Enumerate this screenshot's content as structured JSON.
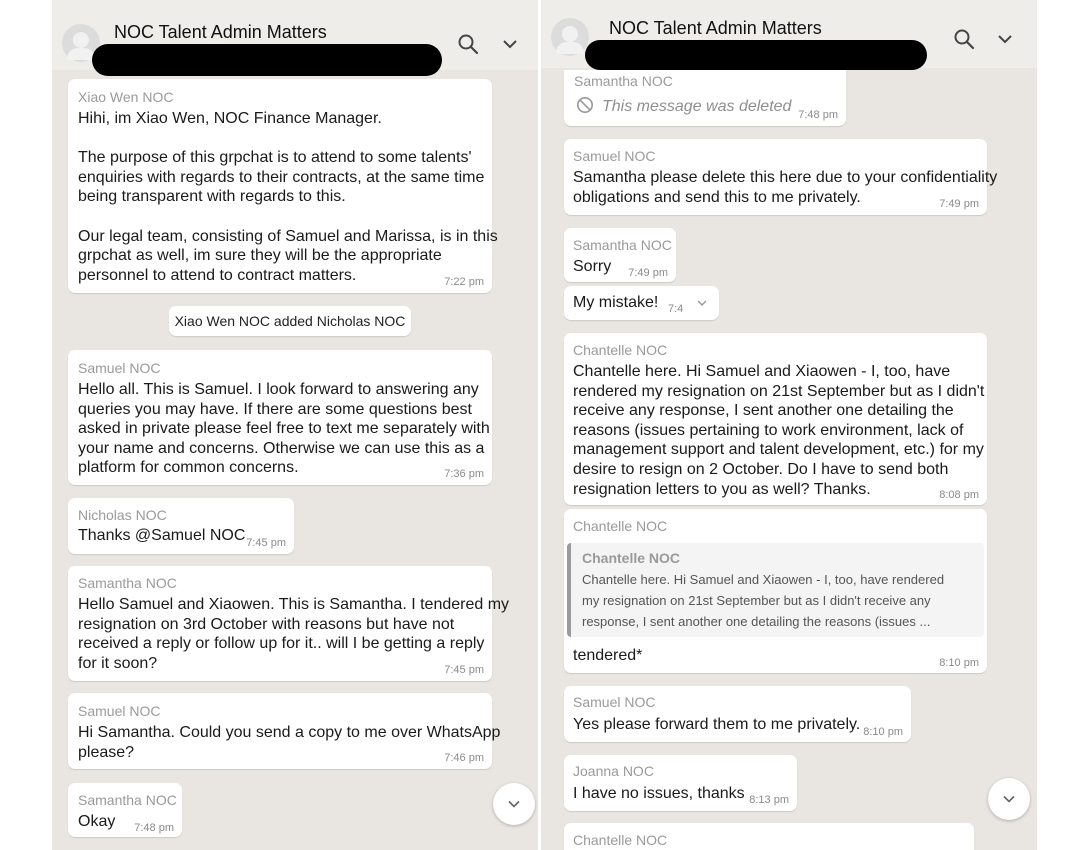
{
  "left": {
    "title": "NOC Talent Admin Matters",
    "messages": [
      {
        "sender": "Xiao Wen NOC",
        "time": "7:22 pm",
        "lines": [
          "Hihi, im Xiao Wen, NOC Finance Manager.",
          "",
          "The purpose of this grpchat is to attend to some talents'",
          "enquiries with regards to their contracts, at the same time",
          "being transparent with regards to this.",
          "",
          "Our legal team, consisting of Samuel and Marissa, is in this",
          "grpchat as well, im sure they will be the appropriate",
          "personnel to attend to contract matters."
        ]
      },
      {
        "sender": "Samuel NOC",
        "time": "7:36 pm",
        "lines": [
          "Hello all. This is Samuel. I look forward to answering any",
          "queries you may have. If there are some questions best",
          "asked in private please feel free to text me separately with",
          "your name and concerns. Otherwise we can use this as a",
          "platform for common concerns."
        ]
      },
      {
        "sender": "Nicholas NOC",
        "time": "7:45 pm",
        "lines": [
          "Thanks @Samuel NOC"
        ]
      },
      {
        "sender": "Samantha NOC",
        "time": "7:45 pm",
        "lines": [
          "Hello Samuel and Xiaowen. This is Samantha. I tendered my",
          "resignation on 3rd October with reasons but have not",
          "received a reply or follow up for it.. will I be getting a reply",
          "for it soon?"
        ]
      },
      {
        "sender": "Samuel NOC",
        "time": "7:46 pm",
        "lines": [
          "Hi Samantha. Could you send a copy to me over WhatsApp",
          "please?"
        ]
      },
      {
        "sender": "Samantha NOC",
        "time": "7:48 pm",
        "lines": [
          "Okay"
        ]
      }
    ],
    "system_message": "Xiao Wen NOC added Nicholas NOC"
  },
  "right": {
    "title": "NOC Talent Admin Matters",
    "messages": [
      {
        "sender": "Samantha NOC",
        "time": "7:48 pm",
        "lines": [
          "This message was deleted"
        ]
      },
      {
        "sender": "Samuel NOC",
        "time": "7:49 pm",
        "lines": [
          "Samantha please delete this here due to your confidentiality",
          "obligations and send this to me privately."
        ]
      },
      {
        "sender": "Samantha NOC",
        "time": "7:49 pm",
        "lines": [
          "Sorry"
        ]
      },
      {
        "sender": "",
        "time": "7:4",
        "lines": [
          "My mistake!"
        ]
      },
      {
        "sender": "Chantelle NOC",
        "time": "8:08 pm",
        "lines": [
          "Chantelle here. Hi Samuel and Xiaowen - I, too, have",
          "rendered my resignation on 21st September but as I didn't",
          "receive any response, I sent another one detailing the",
          "reasons (issues pertaining to work environment, lack of",
          "management support and talent development, etc.) for my",
          "desire to resign on 2 October. Do I have to send both",
          "resignation letters to you as well? Thanks."
        ]
      },
      {
        "sender": "Chantelle NOC",
        "time": "8:10 pm",
        "lines": [
          "tendered*"
        ],
        "quote": {
          "sender": "Chantelle NOC",
          "lines": [
            "Chantelle here. Hi Samuel and Xiaowen - I, too, have rendered",
            "my resignation on 21st September but as I didn't receive any",
            "response, I sent another one detailing the reasons (issues ..."
          ]
        }
      },
      {
        "sender": "Samuel NOC",
        "time": "8:10 pm",
        "lines": [
          "Yes please forward them to me privately."
        ]
      },
      {
        "sender": "Joanna NOC",
        "time": "8:13 pm",
        "lines": [
          "I have no issues, thanks"
        ]
      },
      {
        "sender": "Chantelle NOC",
        "time": "",
        "lines": []
      }
    ]
  },
  "icons": {
    "search": "search-icon",
    "menu": "chevron-down-icon",
    "scroll": "chevron-down-icon",
    "deleted": "deleted-icon",
    "avatar": "group-avatar-icon"
  }
}
